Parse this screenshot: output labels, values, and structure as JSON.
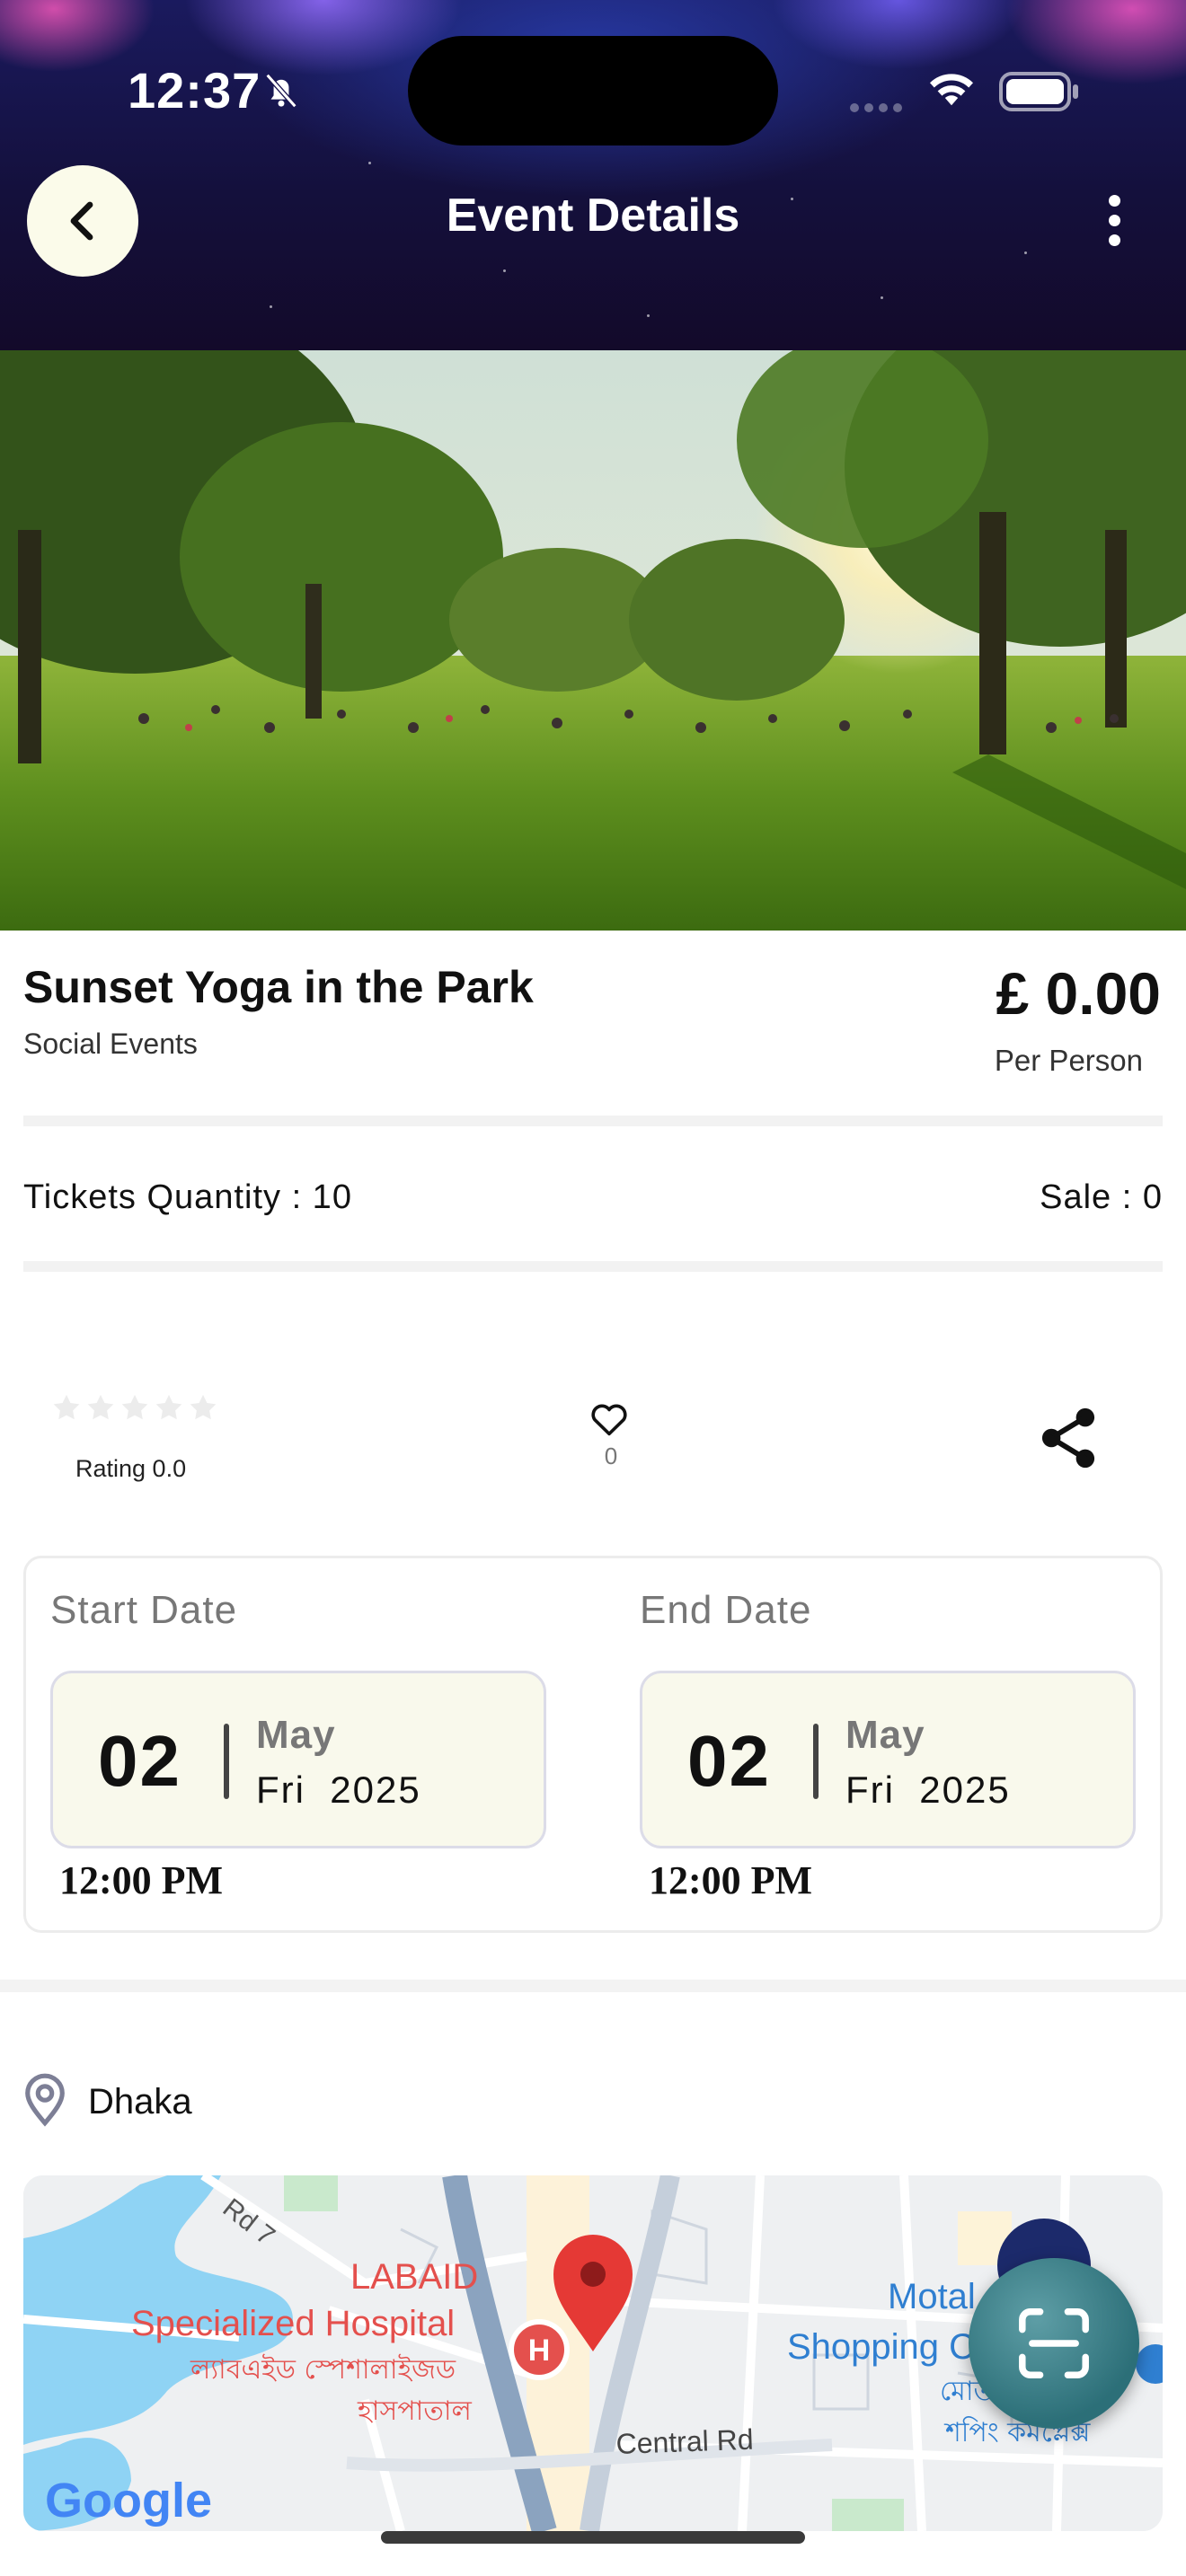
{
  "status_bar": {
    "time": "12:37"
  },
  "header": {
    "title": "Event Details"
  },
  "event": {
    "title": "Sunset Yoga in the Park",
    "category": "Social Events",
    "price": "£ 0.00",
    "price_unit": "Per Person",
    "tickets_quantity": "Tickets Quantity : 10",
    "sale": "Sale : 0",
    "rating_label": "Rating 0.0",
    "rating_value": 0,
    "rating_max": 5,
    "like_count": "0"
  },
  "dates": {
    "start": {
      "label": "Start Date",
      "day": "02",
      "month": "May",
      "weekday_year": "Fri  2025",
      "time": "12:00 PM"
    },
    "end": {
      "label": "End Date",
      "day": "02",
      "month": "May",
      "weekday_year": "Fri  2025",
      "time": "12:00 PM"
    }
  },
  "location": {
    "name": "Dhaka",
    "map_labels": {
      "road": "Rd 7",
      "hospital_en_1": "LABAID",
      "hospital_en_2": "Specialized Hospital",
      "hospital_bn_1": "ল্যাবএইড স্পেশালাইজড",
      "hospital_bn_2": "হাসপাতাল",
      "street": "Central Rd",
      "mall_en_1": "Motal",
      "mall_en_2": "Shopping C",
      "mall_bn_1": "মোতা",
      "mall_bn_2": "শপিং কমপ্লেক্স",
      "hospital_marker": "H",
      "provider": "Google"
    }
  },
  "colors": {
    "accent_card": "#f9f9ec",
    "scan_button": "#2c6f78",
    "map_pin": "#e53935"
  }
}
